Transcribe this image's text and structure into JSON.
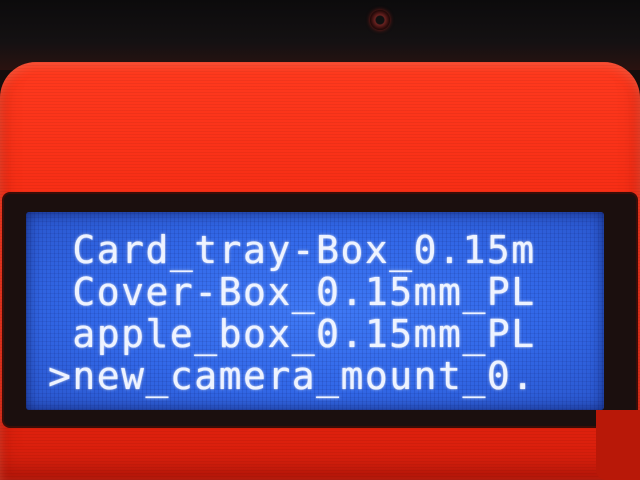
{
  "display": {
    "rows": [
      {
        "cursor": " ",
        "text": "Card_tray-Box_0.15m"
      },
      {
        "cursor": " ",
        "text": "Cover-Box_0.15mm_PL"
      },
      {
        "cursor": " ",
        "text": "apple_box_0.15mm_PL"
      },
      {
        "cursor": ">",
        "text": "new_camera_mount_0."
      }
    ],
    "selected_index": 3
  },
  "colors": {
    "housing": "#f52a12",
    "lcd_background": "#3268e8",
    "lcd_text": "#eef3ff"
  }
}
